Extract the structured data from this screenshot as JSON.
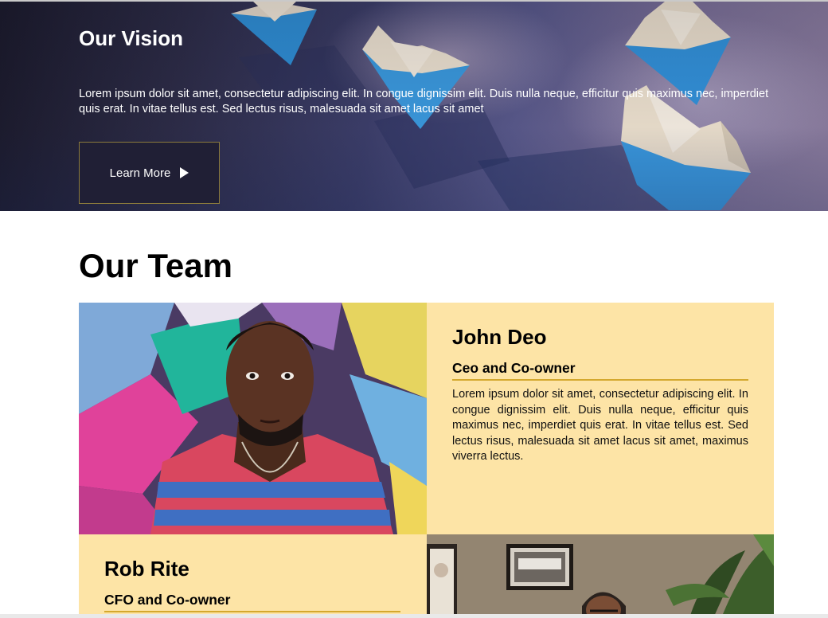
{
  "vision": {
    "title": "Our Vision",
    "text": "Lorem ipsum dolor sit amet, consectetur adipiscing elit. In congue dignissim elit. Duis nulla neque, efficitur quis maximus nec, imperdiet quis erat. In vitae tellus est. Sed lectus risus, malesuada sit amet lacus sit amet",
    "button_label": "Learn More",
    "button_icon": "play-arrow-icon"
  },
  "team": {
    "title": "Our Team",
    "members": [
      {
        "name": "John Deo",
        "role": "Ceo and Co-owner",
        "bio": "Lorem ipsum dolor sit amet, consectetur adipiscing elit. In congue dignissim elit. Duis nulla neque, efficitur quis maximus nec, imperdiet quis erat. In vitae tellus est. Sed lectus risus, malesuada sit amet lacus sit amet, maximus viverra lectus."
      },
      {
        "name": "Rob Rite",
        "role": "CFO and Co-owner"
      }
    ]
  },
  "colors": {
    "card_background": "#fde4a6",
    "role_underline": "#d4a82e",
    "button_background": "#201f35",
    "button_border": "#8b7a3c"
  }
}
